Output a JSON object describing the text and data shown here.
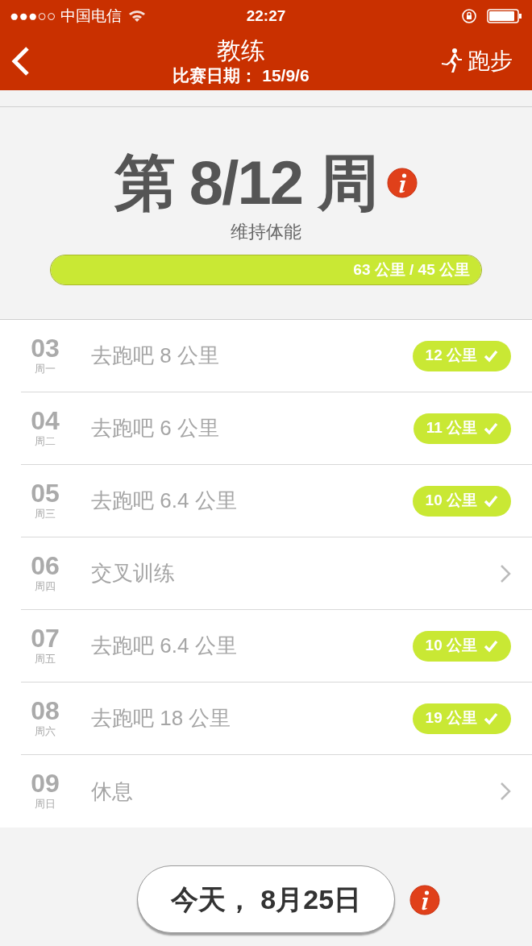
{
  "status_bar": {
    "carrier": "●●●○○ 中国电信",
    "time": "22:27"
  },
  "header": {
    "title": "教练",
    "subtitle": "比赛日期： 15/9/6",
    "action": "跑步"
  },
  "week": {
    "title": "第 8/12 周",
    "phase": "维持体能",
    "progress": {
      "level": 1,
      "reading": "63 公里 / 45 公里"
    }
  },
  "days": [
    {
      "date": "03",
      "weekday": "周一",
      "label": "去跑吧 8 公里",
      "kind": "run",
      "result": "12 公里"
    },
    {
      "date": "04",
      "weekday": "周二",
      "label": "去跑吧 6 公里",
      "kind": "run",
      "result": "11 公里"
    },
    {
      "date": "05",
      "weekday": "周三",
      "label": "去跑吧 6.4 公里",
      "kind": "run",
      "result": "10 公里"
    },
    {
      "date": "06",
      "weekday": "周四",
      "label": "交叉训练",
      "kind": "other"
    },
    {
      "date": "07",
      "weekday": "周五",
      "label": "去跑吧 6.4 公里",
      "kind": "run",
      "result": "10 公里"
    },
    {
      "date": "08",
      "weekday": "周六",
      "label": "去跑吧 18 公里",
      "kind": "run",
      "result": "19 公里"
    },
    {
      "date": "09",
      "weekday": "周日",
      "label": "休息",
      "kind": "other"
    }
  ],
  "today_button": "今天， 8月25日"
}
